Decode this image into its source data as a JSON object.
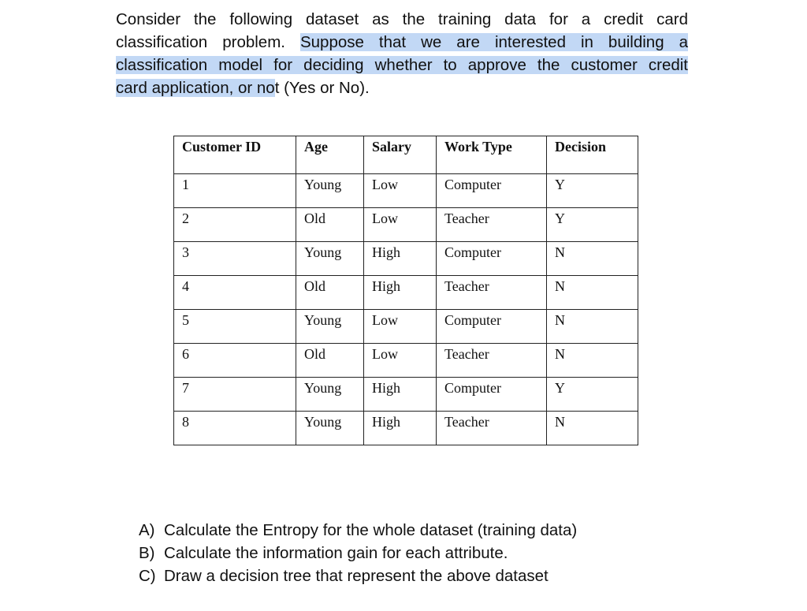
{
  "intro": {
    "lines": [
      {
        "plain": "Consider the following dataset as the training data for a credit card",
        "highlight": ""
      },
      {
        "plain": "classification problem. ",
        "highlight": "Suppose that we are interested in building a"
      },
      {
        "plain": "",
        "highlight": "classification model for deciding whether to approve the customer credit"
      },
      {
        "plain": "",
        "highlight": "card application, or no",
        "after": "t (Yes or No)."
      }
    ]
  },
  "table": {
    "headers": [
      "Customer ID",
      "Age",
      "Salary",
      "Work Type",
      "Decision"
    ],
    "rows": [
      [
        "1",
        "Young",
        "Low",
        "Computer",
        "Y"
      ],
      [
        "2",
        "Old",
        "Low",
        "Teacher",
        "Y"
      ],
      [
        "3",
        "Young",
        "High",
        "Computer",
        "N"
      ],
      [
        "4",
        "Old",
        "High",
        "Teacher",
        "N"
      ],
      [
        "5",
        "Young",
        "Low",
        "Computer",
        "N"
      ],
      [
        "6",
        "Old",
        "Low",
        "Teacher",
        "N"
      ],
      [
        "7",
        "Young",
        "High",
        "Computer",
        "Y"
      ],
      [
        "8",
        "Young",
        "High",
        "Teacher",
        "N"
      ]
    ]
  },
  "questions": [
    {
      "label": "A)",
      "text": "Calculate the Entropy for the whole dataset (training data)"
    },
    {
      "label": "B)",
      "text": "Calculate the information gain for each attribute."
    },
    {
      "label": "C)",
      "text": "Draw a decision tree that represent the above dataset"
    }
  ],
  "colors": {
    "highlight": "#c2d8f5"
  }
}
